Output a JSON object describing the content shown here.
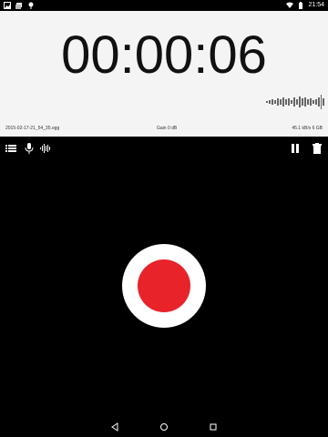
{
  "status_bar": {
    "time": "21:54",
    "left_icons": [
      "image-icon",
      "gallery-icon",
      "location-icon"
    ],
    "right_icons": [
      "wifi-icon",
      "battery-icon"
    ]
  },
  "recorder": {
    "elapsed": "00:00:06",
    "filename": "2015-02-17-21_54_35.ogg",
    "gain": "Gain 0 dB",
    "rate_storage": "45.1 kB/s 6 GB",
    "waveform_color": "#666666"
  },
  "toolbar": {
    "left": [
      "list-icon",
      "microphone-icon",
      "waveform-icon"
    ],
    "right": [
      "pause-icon",
      "delete-icon"
    ]
  },
  "record_button": {
    "outer_color": "#ffffff",
    "inner_color": "#e8232a"
  },
  "nav": [
    "back-icon",
    "home-icon",
    "recents-icon"
  ]
}
